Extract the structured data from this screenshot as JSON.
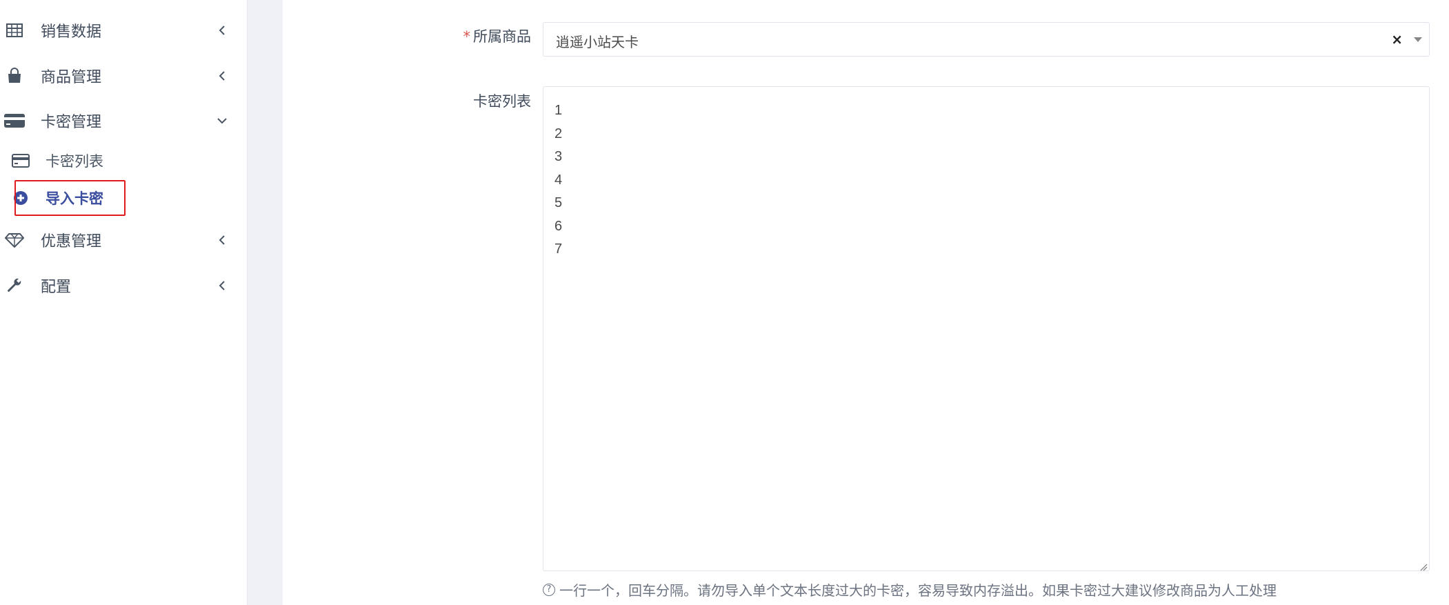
{
  "sidebar": {
    "items": [
      {
        "label": "销售数据",
        "icon": "table-icon"
      },
      {
        "label": "商品管理",
        "icon": "shopping-bag-icon"
      },
      {
        "label": "卡密管理",
        "icon": "credit-card-icon"
      },
      {
        "label": "优惠管理",
        "icon": "diamond-icon"
      },
      {
        "label": "配置",
        "icon": "wrench-icon"
      }
    ],
    "subitems": [
      {
        "label": "卡密列表",
        "icon": "credit-card-outline-icon"
      },
      {
        "label": "导入卡密",
        "icon": "plus-circle-icon"
      }
    ]
  },
  "form": {
    "product_label": "所属商品",
    "product_required_mark": "*",
    "product_value": "逍遥小站天卡",
    "product_clear": "×",
    "cards_label": "卡密列表",
    "cards_lines": [
      "1",
      "2",
      "3",
      "4",
      "5",
      "6",
      "7"
    ],
    "help_text": "一行一个，回车分隔。请勿导入单个文本长度过大的卡密，容易导致内存溢出。如果卡密过大建议修改商品为人工处理",
    "help_icon": "?"
  },
  "colors": {
    "active": "#3a4d9e",
    "highlight": "#e0191c",
    "required": "#d9534f"
  }
}
